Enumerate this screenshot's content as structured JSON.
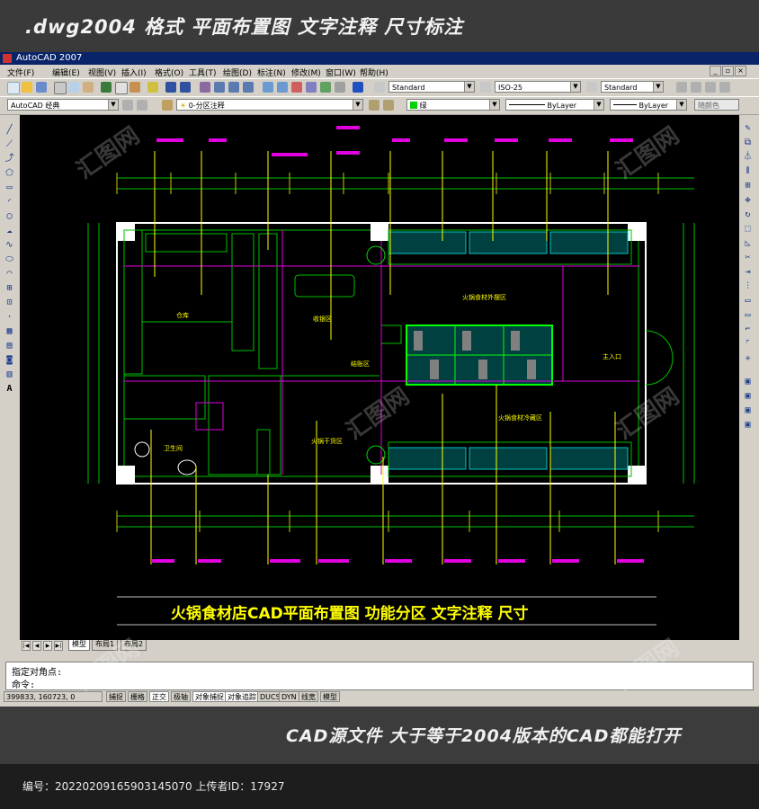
{
  "banner_top": ".dwg2004 格式  平面布置图 文字注释 尺寸标注",
  "window_title": "AutoCAD 2007",
  "menu": [
    "文件(F)",
    "编辑(E)",
    "视图(V)",
    "插入(I)",
    "格式(O)",
    "工具(T)",
    "绘图(D)",
    "标注(N)",
    "修改(M)",
    "窗口(W)",
    "帮助(H)"
  ],
  "toolbar": {
    "text_style": "Standard",
    "dim_style": "ISO-25",
    "table_style": "Standard",
    "workspace": "AutoCAD 经典",
    "layer": "0-分区注释",
    "color": "绿",
    "linetype": "ByLayer",
    "lineweight": "ByLayer",
    "plotstyle": "随颜色"
  },
  "drawing": {
    "rooms": {
      "warehouse": "仓库",
      "cashier": "收银区",
      "checkout": "结账区",
      "hotpot_material": "火锅食材外摆区",
      "hotpot_cold": "火锅食材冷藏区",
      "hotpot_dry": "火锅干货区",
      "toilet": "卫生间",
      "entrance": "主入口"
    },
    "caption": "火锅食材店CAD平面布置图   功能分区   文字注释   尺寸"
  },
  "tabs": [
    "模型",
    "布局1",
    "布局2"
  ],
  "command": {
    "line1": "指定对角点:",
    "line2": "命令:"
  },
  "status": {
    "coords": "399833, 160723, 0",
    "buttons": [
      "捕捉",
      "栅格",
      "正交",
      "极轴",
      "对象捕捉",
      "对象追踪",
      "DUCS",
      "DYN",
      "线宽",
      "模型"
    ]
  },
  "banner_mid": "CAD源文件  大于等于2004版本的CAD都能打开",
  "footer": "编号：20220209165903145070 上传者ID：17927",
  "watermark": "汇图网"
}
